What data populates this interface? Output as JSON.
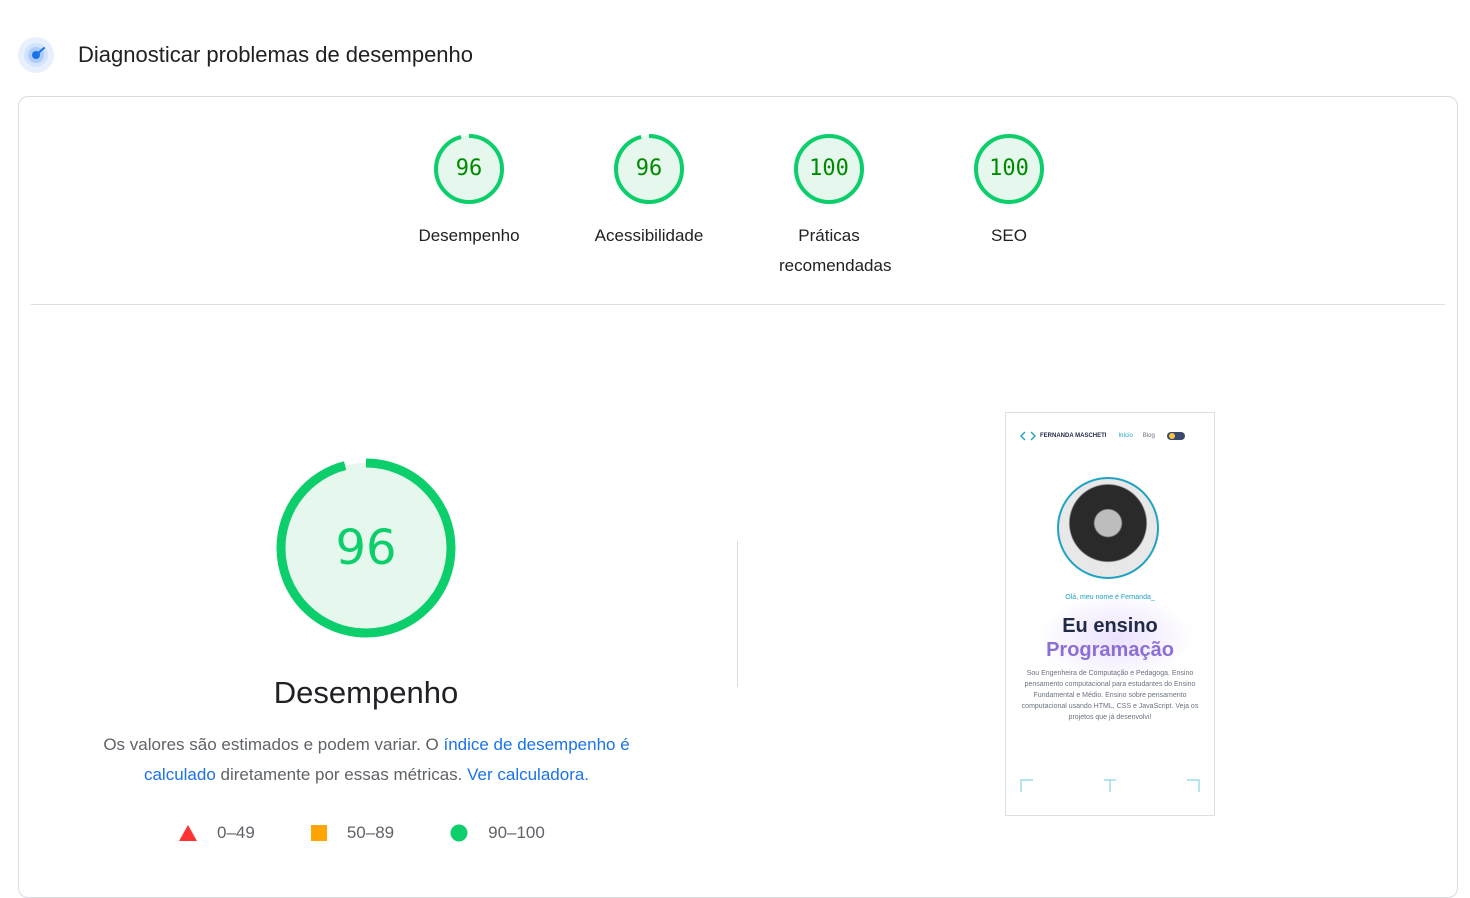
{
  "header": {
    "title": "Diagnosticar problemas de desempenho",
    "icon": "lighthouse-gauge-icon"
  },
  "scores": [
    {
      "value": "96",
      "label": "Desempenho",
      "fraction": 0.96
    },
    {
      "value": "96",
      "label": "Acessibilidade",
      "fraction": 0.96
    },
    {
      "value": "100",
      "label": "Práticas recomendadas",
      "fraction": 1.0
    },
    {
      "value": "100",
      "label": "SEO",
      "fraction": 1.0
    }
  ],
  "performance": {
    "value": "96",
    "fraction": 0.96,
    "title": "Desempenho",
    "desc_part1": "Os valores são estimados e podem variar. O ",
    "desc_link1": "índice de desempenho é calculado",
    "desc_part2": " diretamente por essas métricas. ",
    "desc_link2": "Ver calculadora."
  },
  "legend": [
    {
      "shape": "triangle",
      "color": "#ff3333",
      "range": "0–49"
    },
    {
      "shape": "square",
      "color": "#ffa400",
      "range": "50–89"
    },
    {
      "shape": "circle",
      "color": "#0cce6b",
      "range": "90–100"
    }
  ],
  "colors": {
    "pass": "#0cce6b",
    "pass_bg": "#e6f8ee",
    "pass_text": "#008a00",
    "link": "#1a73e8"
  },
  "screenshot": {
    "brand": "FERNANDA MASCHETI",
    "nav_home": "Início",
    "nav_blog": "Blog",
    "hello": "Olá, meu nome é Fernanda_",
    "headline1": "Eu ensino",
    "headline2": "Programação",
    "paragraph": "Sou Engenheira de Computação e Pedagoga. Ensino pensamento computacional para estudantes do Ensino Fundamental e Médio. Ensino sobre pensamento computacional usando HTML, CSS e JavaScript. Veja os projetos que já desenvolvi!"
  }
}
